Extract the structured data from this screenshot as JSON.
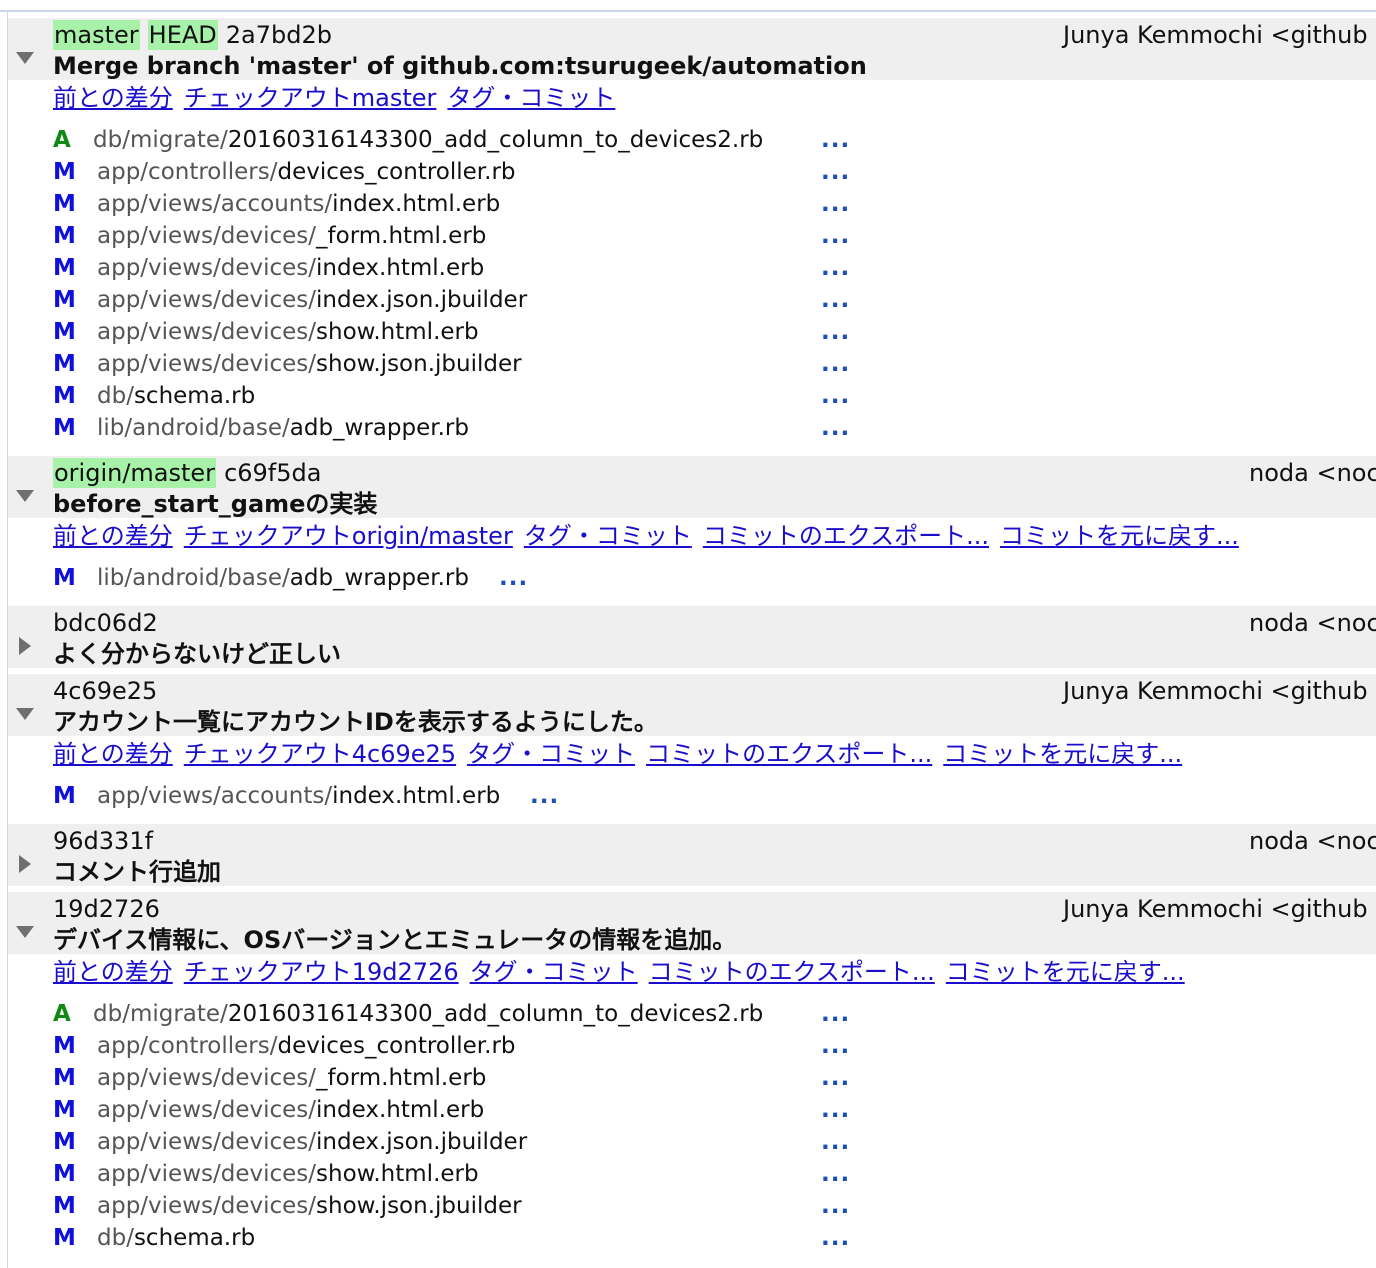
{
  "commits": [
    {
      "refs": [
        "master",
        "HEAD"
      ],
      "hash": "2a7bd2b",
      "author": "Junya Kemmochi <github",
      "message": "Merge branch 'master' of github.com:tsurugeek/automation",
      "expanded": true,
      "actions": [
        "前との差分",
        "チェックアウトmaster",
        "タグ・コミット"
      ],
      "files": [
        {
          "status": "A",
          "dir": "db/migrate/",
          "name": "20160316143300_add_column_to_devices2.rb"
        },
        {
          "status": "M",
          "dir": "app/controllers/",
          "name": "devices_controller.rb"
        },
        {
          "status": "M",
          "dir": "app/views/accounts/",
          "name": "index.html.erb"
        },
        {
          "status": "M",
          "dir": "app/views/devices/",
          "name": "_form.html.erb"
        },
        {
          "status": "M",
          "dir": "app/views/devices/",
          "name": "index.html.erb"
        },
        {
          "status": "M",
          "dir": "app/views/devices/",
          "name": "index.json.jbuilder"
        },
        {
          "status": "M",
          "dir": "app/views/devices/",
          "name": "show.html.erb"
        },
        {
          "status": "M",
          "dir": "app/views/devices/",
          "name": "show.json.jbuilder"
        },
        {
          "status": "M",
          "dir": "db/",
          "name": "schema.rb"
        },
        {
          "status": "M",
          "dir": "lib/android/base/",
          "name": "adb_wrapper.rb"
        }
      ]
    },
    {
      "refs": [
        "origin/master"
      ],
      "hash": "c69f5da",
      "author": "noda <noc",
      "message": "before_start_gameの実装",
      "expanded": true,
      "actions": [
        "前との差分",
        "チェックアウトorigin/master",
        "タグ・コミット",
        "コミットのエクスポート...",
        "コミットを元に戻す..."
      ],
      "files": [
        {
          "status": "M",
          "dir": "lib/android/base/",
          "name": "adb_wrapper.rb"
        }
      ]
    },
    {
      "refs": [],
      "hash": "bdc06d2",
      "author": "noda <noc",
      "message": "よく分からないけど正しい",
      "expanded": false,
      "actions": [],
      "files": []
    },
    {
      "refs": [],
      "hash": "4c69e25",
      "author": "Junya Kemmochi <github",
      "message": "アカウント一覧にアカウントIDを表示するようにした。",
      "expanded": true,
      "actions": [
        "前との差分",
        "チェックアウト4c69e25",
        "タグ・コミット",
        "コミットのエクスポート...",
        "コミットを元に戻す..."
      ],
      "files": [
        {
          "status": "M",
          "dir": "app/views/accounts/",
          "name": "index.html.erb"
        }
      ]
    },
    {
      "refs": [],
      "hash": "96d331f",
      "author": "noda <noc",
      "message": "コメント行追加",
      "expanded": false,
      "actions": [],
      "files": []
    },
    {
      "refs": [],
      "hash": "19d2726",
      "author": "Junya Kemmochi <github",
      "message": "デバイス情報に、OSバージョンとエミュレータの情報を追加。",
      "expanded": true,
      "actions": [
        "前との差分",
        "チェックアウト19d2726",
        "タグ・コミット",
        "コミットのエクスポート...",
        "コミットを元に戻す..."
      ],
      "files": [
        {
          "status": "A",
          "dir": "db/migrate/",
          "name": "20160316143300_add_column_to_devices2.rb"
        },
        {
          "status": "M",
          "dir": "app/controllers/",
          "name": "devices_controller.rb"
        },
        {
          "status": "M",
          "dir": "app/views/devices/",
          "name": "_form.html.erb"
        },
        {
          "status": "M",
          "dir": "app/views/devices/",
          "name": "index.html.erb"
        },
        {
          "status": "M",
          "dir": "app/views/devices/",
          "name": "index.json.jbuilder"
        },
        {
          "status": "M",
          "dir": "app/views/devices/",
          "name": "show.html.erb"
        },
        {
          "status": "M",
          "dir": "app/views/devices/",
          "name": "show.json.jbuilder"
        },
        {
          "status": "M",
          "dir": "db/",
          "name": "schema.rb"
        }
      ]
    }
  ],
  "more_label": "...",
  "colors": {
    "ref_bg": "#a8f1a8",
    "link": "#1a0dcc",
    "added": "#118811",
    "modified": "#1010dd",
    "header_bg": "#efefef"
  }
}
